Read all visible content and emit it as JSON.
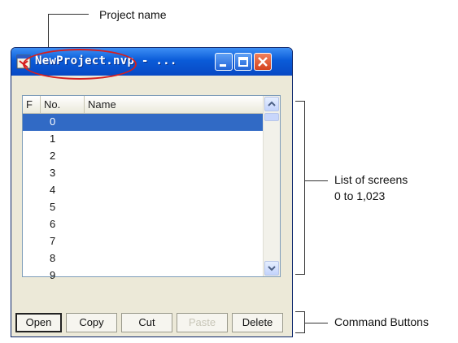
{
  "annotations": {
    "project_name": "Project name",
    "screen_list": [
      "List of screens",
      "0 to 1,023"
    ],
    "command_buttons": "Command Buttons"
  },
  "window": {
    "title": "NewProject.nvp - ...",
    "icon": "project-app-icon",
    "controls": [
      "minimize-icon",
      "maximize-icon",
      "close-icon"
    ]
  },
  "list": {
    "columns": [
      "F",
      "No.",
      "Name"
    ],
    "rows": [
      "0",
      "1",
      "2",
      "3",
      "4",
      "5",
      "6",
      "7",
      "8",
      "9"
    ],
    "selected": "0"
  },
  "buttons": {
    "open": "Open",
    "copy": "Copy",
    "cut": "Cut",
    "paste": "Paste",
    "delete": "Delete"
  },
  "colors": {
    "titlebar": "#0a5bd8",
    "selection": "#316ac5",
    "highlight_ellipse": "#d61e1e"
  }
}
